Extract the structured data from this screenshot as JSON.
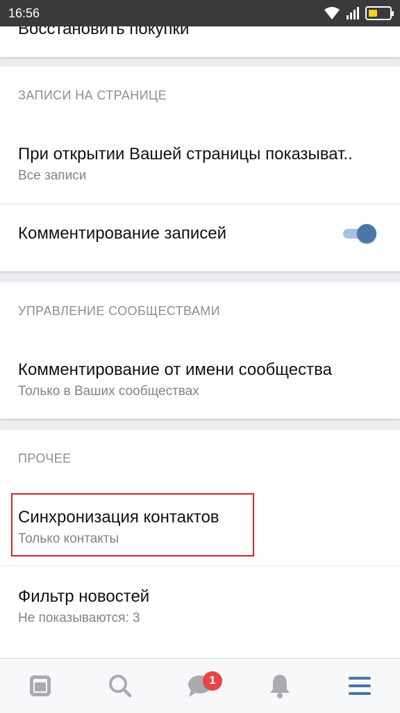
{
  "status_bar": {
    "time": "16:56"
  },
  "top_row": {
    "title": "Восстановить покупки"
  },
  "section_posts": {
    "title": "ЗАПИСИ НА СТРАНИЦЕ",
    "rows": [
      {
        "title": "При открытии Вашей страницы показыват..",
        "subtitle": "Все записи"
      },
      {
        "title": "Комментирование записей",
        "toggle_on": true
      }
    ]
  },
  "section_communities": {
    "title": "УПРАВЛЕНИЕ СООБЩЕСТВАМИ",
    "rows": [
      {
        "title": "Комментирование от имени сообщества",
        "subtitle": "Только в Ваших сообществах"
      }
    ]
  },
  "section_other": {
    "title": "ПРОЧЕЕ",
    "rows": [
      {
        "title": "Синхронизация контактов",
        "subtitle": "Только контакты"
      },
      {
        "title": "Фильтр новостей",
        "subtitle": "Не показываются: 3"
      }
    ]
  },
  "bottom_nav": {
    "items": [
      "news-icon",
      "search-icon",
      "messages-icon",
      "notifications-icon",
      "menu-icon"
    ],
    "messages_badge": "1"
  },
  "colors": {
    "accent": "#4a76a8",
    "highlight_border": "#d0242a",
    "badge": "#e64646"
  }
}
